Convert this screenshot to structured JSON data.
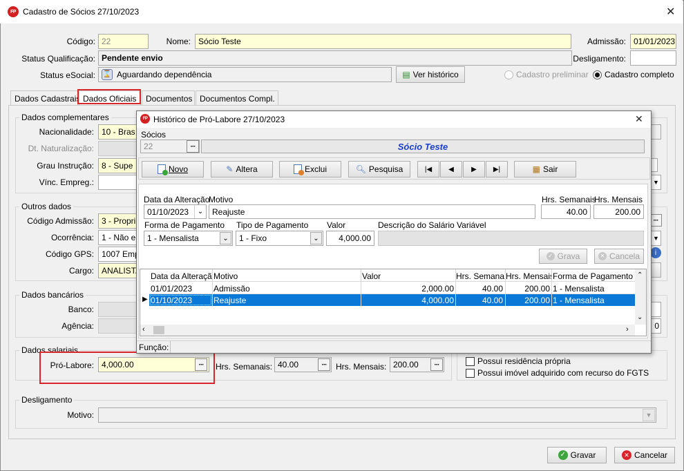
{
  "main": {
    "title": "Cadastro de Sócios 27/10/2023",
    "logo_text": "FP",
    "codigo_label": "Código:",
    "codigo_value": "22",
    "nome_label": "Nome:",
    "nome_value": "Sócio Teste",
    "admissao_label": "Admissão:",
    "admissao_value": "01/01/2023",
    "status_qual_label": "Status Qualificação:",
    "status_qual_value": "Pendente envio",
    "desligamento_label": "Desligamento:",
    "desligamento_value": "",
    "status_esocial_label": "Status eSocial:",
    "status_esocial_value": "Aguardando dependência",
    "ver_historico": "Ver histórico",
    "cadastro_preliminar": "Cadastro preliminar",
    "cadastro_completo": "Cadastro completo",
    "tabs": [
      "Dados Cadastrais",
      "Dados Oficiais",
      "Documentos",
      "Documentos Compl."
    ],
    "dados_complementares": "Dados complementares",
    "nacionalidade_label": "Nacionalidade:",
    "nacionalidade_value": "10  -  Bras",
    "naturalizacao_label": "Dt. Naturalização:",
    "grau_label": "Grau Instrução:",
    "grau_value": "8  -  Supe",
    "vinc_label": "Vínc. Empreg.:",
    "outros_dados": "Outros dados",
    "cod_admissao_label": "Código Admissão:",
    "cod_admissao_value": "3 - Propri",
    "ocorrencia_label": "Ocorrência:",
    "ocorrencia_value": "1 - Não e",
    "codigo_gps_label": "Código GPS:",
    "codigo_gps_value": "1007 Emp",
    "cargo_label": "Cargo:",
    "cargo_value": "ANALISTA",
    "dados_bancarios": "Dados bancários",
    "banco_label": "Banco:",
    "agencia_label": "Agência:",
    "agencia_right_value": "0",
    "dados_salariais": "Dados salariais",
    "pro_labore_label": "Pró-Labore:",
    "pro_labore_value": "4,000.00",
    "hrs_semanais_label": "Hrs. Semanais:",
    "hrs_semanais_value": "40.00",
    "hrs_mensais_label": "Hrs. Mensais:",
    "hrs_mensais_value": "200.00",
    "residencia": "Possui residência própria",
    "imovel": "Possui imóvel adquirido com recurso do FGTS",
    "desligamento_group": "Desligamento",
    "motivo_label": "Motivo:",
    "gravar": "Gravar",
    "cancelar": "Cancelar"
  },
  "dialog": {
    "title": "Histórico de Pró-Labore 27/10/2023",
    "socios_label": "Sócios",
    "socio_code": "22",
    "socio_name": "Sócio Teste",
    "toolbar": {
      "novo": "Novo",
      "altera": "Altera",
      "exclui": "Exclui",
      "pesquisa": "Pesquisa",
      "sair": "Sair"
    },
    "data_alteracao_label": "Data da Alteração",
    "data_alteracao_value": "01/10/2023",
    "motivo_label": "Motivo",
    "motivo_value": "Reajuste",
    "hrs_semanais_label": "Hrs. Semanais",
    "hrs_semanais_value": "40.00",
    "hrs_mensais_label": "Hrs. Mensais",
    "hrs_mensais_value": "200.00",
    "forma_label": "Forma de Pagamento",
    "forma_value": "1 - Mensalista",
    "tipo_label": "Tipo de Pagamento",
    "tipo_value": "1 - Fixo",
    "valor_label": "Valor",
    "valor_value": "4,000.00",
    "descricao_label": "Descrição do Salário Variável",
    "grava": "Grava",
    "cancela": "Cancela",
    "columns": [
      "Data da Alteração",
      "Motivo",
      "Valor",
      "Hrs. Semanais",
      "Hrs. Mensais",
      "Forma de Pagamento"
    ],
    "rows": [
      [
        "01/01/2023",
        "Admissão",
        "2,000.00",
        "40.00",
        "200.00",
        "1 - Mensalista"
      ],
      [
        "01/10/2023",
        "Reajuste",
        "4,000.00",
        "40.00",
        "200.00",
        "1 - Mensalista"
      ]
    ],
    "funcao_label": "Função:"
  },
  "colors": {
    "accent_red": "#d9242b",
    "selection": "#0a78d7",
    "yellow_field": "#ffffd7"
  }
}
